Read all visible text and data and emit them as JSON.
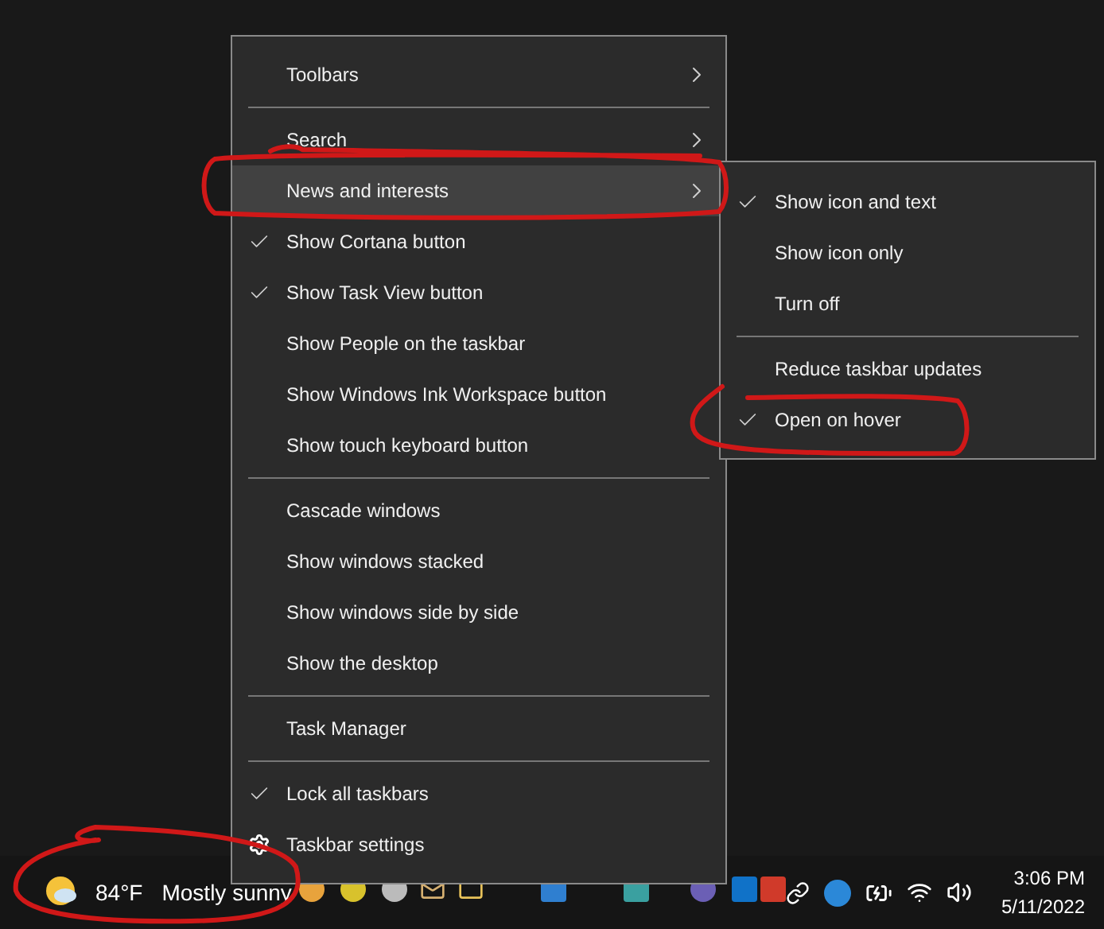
{
  "context_menu": {
    "items": [
      {
        "kind": "item",
        "label": "Toolbars",
        "checked": false,
        "submenu": true,
        "selected": false
      },
      {
        "kind": "separator"
      },
      {
        "kind": "item",
        "label": "Search",
        "checked": false,
        "submenu": true,
        "selected": false
      },
      {
        "kind": "item",
        "label": "News and interests",
        "checked": false,
        "submenu": true,
        "selected": true
      },
      {
        "kind": "item",
        "label": "Show Cortana button",
        "checked": true,
        "submenu": false,
        "selected": false
      },
      {
        "kind": "item",
        "label": "Show Task View button",
        "checked": true,
        "submenu": false,
        "selected": false
      },
      {
        "kind": "item",
        "label": "Show People on the taskbar",
        "checked": false,
        "submenu": false,
        "selected": false
      },
      {
        "kind": "item",
        "label": "Show Windows Ink Workspace button",
        "checked": false,
        "submenu": false,
        "selected": false
      },
      {
        "kind": "item",
        "label": "Show touch keyboard button",
        "checked": false,
        "submenu": false,
        "selected": false
      },
      {
        "kind": "separator"
      },
      {
        "kind": "item",
        "label": "Cascade windows",
        "checked": false,
        "submenu": false,
        "selected": false
      },
      {
        "kind": "item",
        "label": "Show windows stacked",
        "checked": false,
        "submenu": false,
        "selected": false
      },
      {
        "kind": "item",
        "label": "Show windows side by side",
        "checked": false,
        "submenu": false,
        "selected": false
      },
      {
        "kind": "item",
        "label": "Show the desktop",
        "checked": false,
        "submenu": false,
        "selected": false
      },
      {
        "kind": "separator"
      },
      {
        "kind": "item",
        "label": "Task Manager",
        "checked": false,
        "submenu": false,
        "selected": false
      },
      {
        "kind": "separator"
      },
      {
        "kind": "item",
        "label": "Lock all taskbars",
        "checked": true,
        "submenu": false,
        "selected": false
      },
      {
        "kind": "settings",
        "label": "Taskbar settings",
        "checked": false,
        "submenu": false,
        "selected": false
      }
    ]
  },
  "submenu": {
    "items": [
      {
        "kind": "item",
        "label": "Show icon and text",
        "checked": true
      },
      {
        "kind": "item",
        "label": "Show icon only",
        "checked": false
      },
      {
        "kind": "item",
        "label": "Turn off",
        "checked": false
      },
      {
        "kind": "separator"
      },
      {
        "kind": "item",
        "label": "Reduce taskbar updates",
        "checked": false
      },
      {
        "kind": "item",
        "label": "Open on hover",
        "checked": true
      }
    ]
  },
  "taskbar": {
    "weather": {
      "temperature": "84°F",
      "condition": "Mostly sunny"
    },
    "clock": {
      "time": "3:06 PM",
      "date": "5/11/2022"
    }
  }
}
